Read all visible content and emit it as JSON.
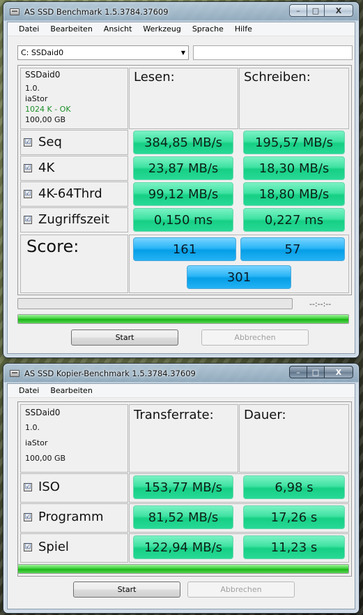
{
  "bench": {
    "title": "AS SSD Benchmark 1.5.3784.37609",
    "menu": [
      "Datei",
      "Bearbeiten",
      "Ansicht",
      "Werkzeug",
      "Sprache",
      "Hilfe"
    ],
    "drive": "C: SSDaid0",
    "info": {
      "name": "SSDaid0",
      "firmware": "1.0.",
      "driver": "iaStor",
      "alignment": "1024 K - OK",
      "size": "100,00 GB"
    },
    "headers": {
      "read": "Lesen:",
      "write": "Schreiben:"
    },
    "rows": [
      {
        "label": "Seq",
        "read": "384,85 MB/s",
        "write": "195,57 MB/s",
        "checked": true
      },
      {
        "label": "4K",
        "read": "23,87 MB/s",
        "write": "18,30 MB/s",
        "checked": true
      },
      {
        "label": "4K-64Thrd",
        "read": "99,12 MB/s",
        "write": "18,80 MB/s",
        "checked": true
      },
      {
        "label": "Zugriffszeit",
        "read": "0,150 ms",
        "write": "0,227 ms",
        "checked": true
      }
    ],
    "score": {
      "label": "Score:",
      "read": "161",
      "write": "57",
      "total": "301"
    },
    "timer": "--:--:--",
    "progress": 1.0,
    "start_label": "Start",
    "cancel_label": "Abbrechen"
  },
  "copy": {
    "title": "AS SSD Kopier-Benchmark 1.5.3784.37609",
    "menu": [
      "Datei",
      "Bearbeiten"
    ],
    "info": {
      "name": "SSDaid0",
      "firmware": "1.0.",
      "driver": "iaStor",
      "size": "100,00 GB"
    },
    "headers": {
      "rate": "Transferrate:",
      "duration": "Dauer:"
    },
    "rows": [
      {
        "label": "ISO",
        "rate": "153,77 MB/s",
        "duration": "6,98 s",
        "checked": true
      },
      {
        "label": "Programm",
        "rate": "81,52 MB/s",
        "duration": "17,26 s",
        "checked": true
      },
      {
        "label": "Spiel",
        "rate": "122,94 MB/s",
        "duration": "11,23 s",
        "checked": true
      }
    ],
    "progress": 1.0,
    "start_label": "Start",
    "cancel_label": "Abbrechen"
  },
  "window_controls": {
    "minimize": "–",
    "maximize": "□",
    "close": "X"
  },
  "checkbox_glyph": "☑"
}
